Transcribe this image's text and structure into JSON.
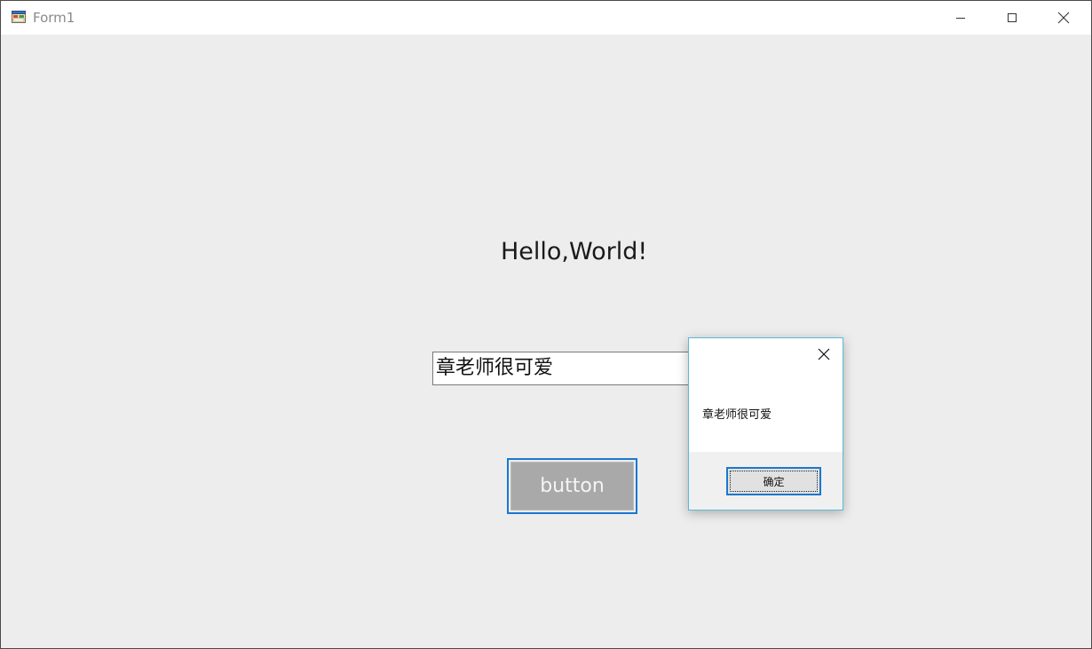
{
  "window": {
    "title": "Form1",
    "icon": "app-form-icon",
    "controls": [
      "minimize-icon",
      "maximize-icon",
      "close-icon"
    ]
  },
  "form": {
    "label_text": "Hello,World!",
    "textbox_value": "章老师很可爱",
    "button_label": "button"
  },
  "message_box": {
    "message": "章老师很可爱",
    "ok_label": "确定",
    "close_icon": "close-icon"
  },
  "colors": {
    "accent": "#1a78d0",
    "form_background": "#ededed",
    "button_face": "#a9a9a9",
    "messagebox_border": "#5bb9d6"
  }
}
